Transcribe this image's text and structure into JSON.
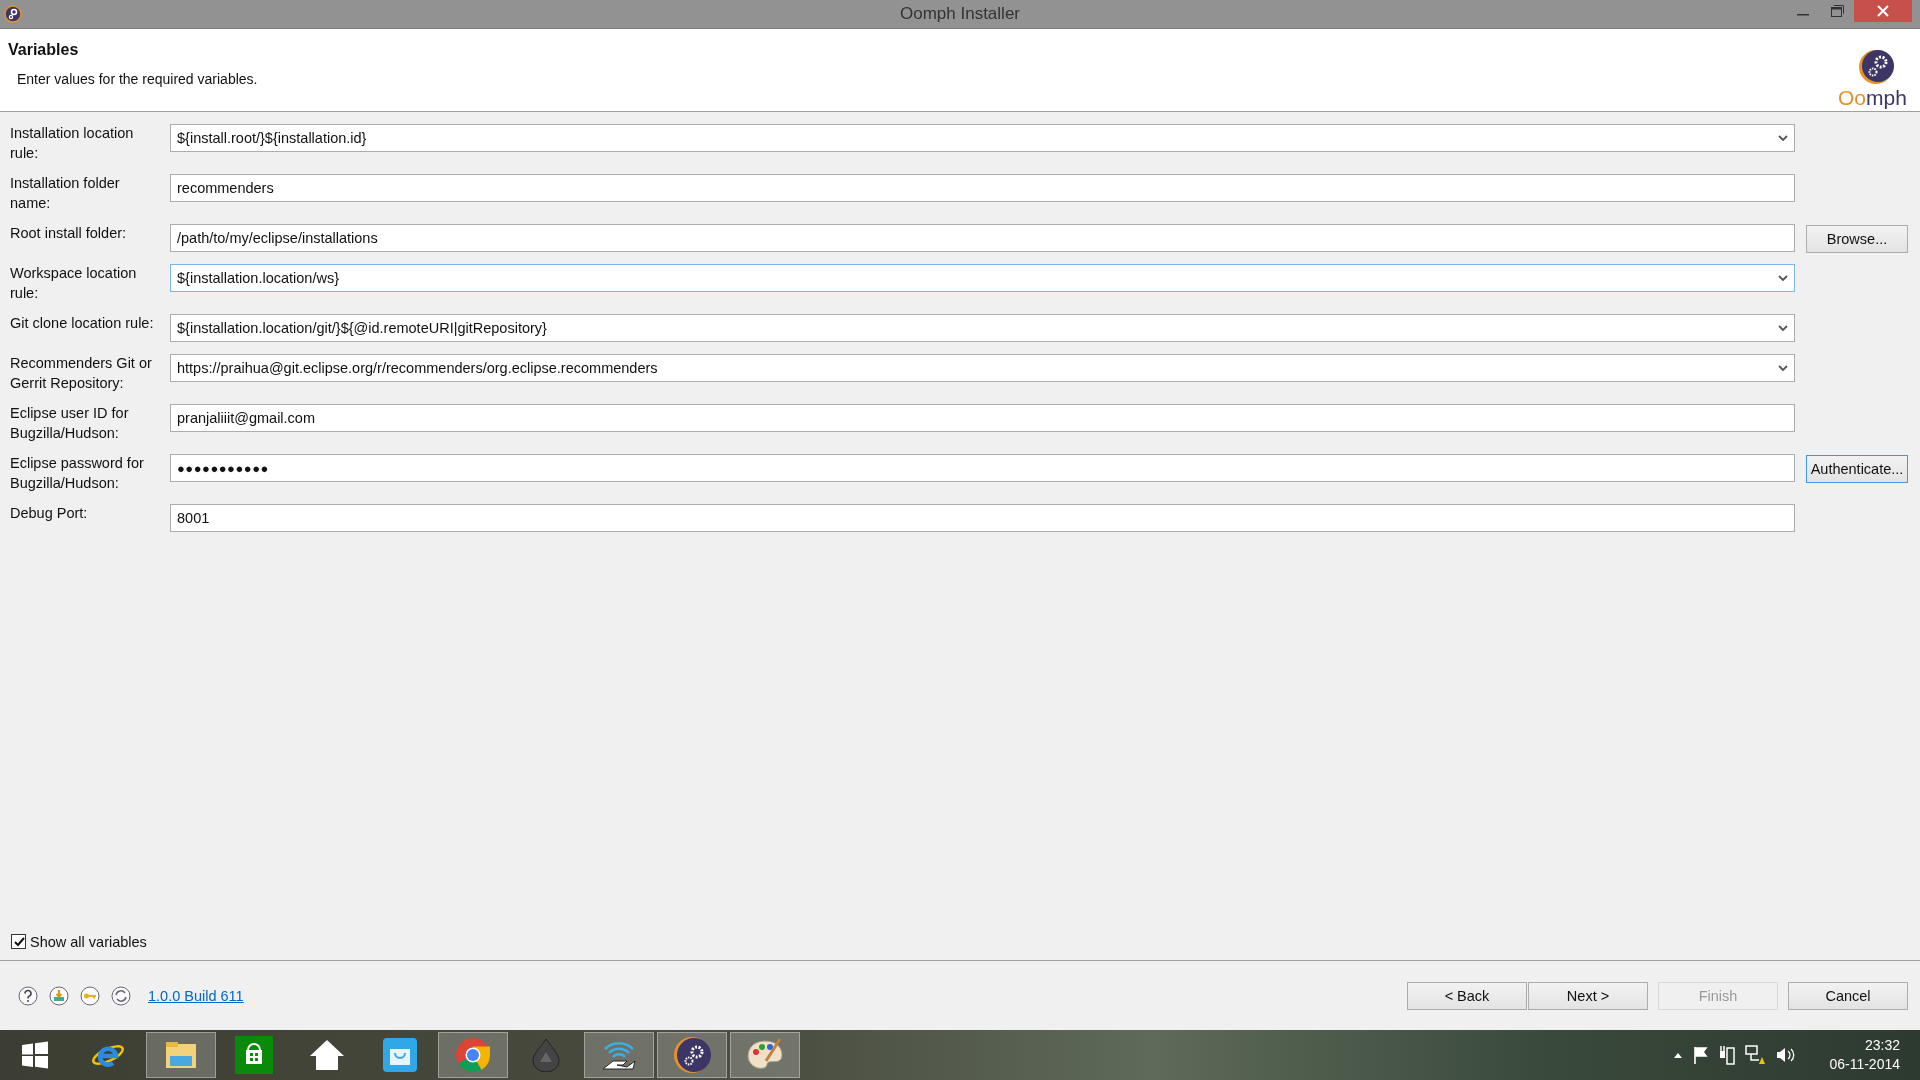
{
  "window": {
    "title": "Oomph Installer"
  },
  "header": {
    "title": "Variables",
    "description": "Enter values for the required variables.",
    "logo_text": "Oomph"
  },
  "variables": [
    {
      "label": "Installation location rule:",
      "kind": "combo",
      "value": "${install.root/}${installation.id}",
      "focused": false
    },
    {
      "label": "Installation folder name:",
      "kind": "text",
      "value": "recommenders",
      "focused": false
    },
    {
      "label": "Root install folder:",
      "kind": "text",
      "value": "/path/to/my/eclipse/installations",
      "focused": false,
      "button": {
        "label": "Browse...",
        "focused": false
      }
    },
    {
      "label": "Workspace location rule:",
      "kind": "combo",
      "value": "${installation.location/ws}",
      "focused": true
    },
    {
      "label": "Git clone location rule:",
      "kind": "combo",
      "value": "${installation.location/git/}${@id.remoteURI|gitRepository}",
      "focused": false
    },
    {
      "label": "Recommenders Git or Gerrit Repository:",
      "kind": "combo",
      "value": "https://praihua@git.eclipse.org/r/recommenders/org.eclipse.recommenders",
      "focused": false
    },
    {
      "label": "Eclipse user ID for Bugzilla/Hudson:",
      "kind": "text",
      "value": "pranjaliiit@gmail.com",
      "focused": false
    },
    {
      "label": "Eclipse password for Bugzilla/Hudson:",
      "kind": "password",
      "value": "●●●●●●●●●●●",
      "focused": false,
      "button": {
        "label": "Authenticate...",
        "focused": true
      }
    },
    {
      "label": "Debug Port:",
      "kind": "text",
      "value": "8001",
      "focused": false
    }
  ],
  "show_all": {
    "label": "Show all variables",
    "checked": true
  },
  "footer": {
    "version_link": "1.0.0 Build 611",
    "buttons": [
      {
        "label": "< Back",
        "disabled": false
      },
      {
        "label": "Next >",
        "disabled": false
      },
      {
        "label": "Finish",
        "disabled": true
      },
      {
        "label": "Cancel",
        "disabled": false
      }
    ]
  },
  "taskbar": {
    "items": [
      {
        "running": false
      },
      {
        "running": false
      },
      {
        "running": true
      },
      {
        "running": false
      },
      {
        "running": false
      },
      {
        "running": false
      },
      {
        "running": true
      },
      {
        "running": false
      },
      {
        "running": true
      },
      {
        "running": true
      },
      {
        "running": true
      }
    ],
    "clock": {
      "time": "23:32",
      "date": "06-11-2014"
    }
  }
}
